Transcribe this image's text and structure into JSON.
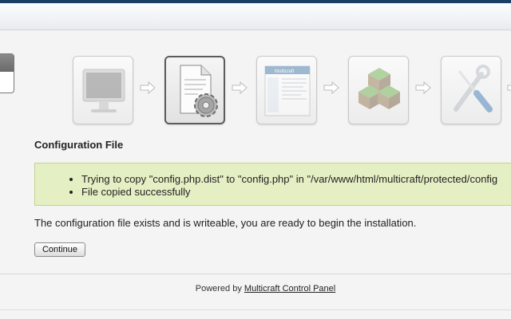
{
  "wizard": {
    "steps": [
      {
        "name": "welcome",
        "icon": "monitor-icon",
        "state": "completed"
      },
      {
        "name": "configuration-file",
        "icon": "config-document-gear-icon",
        "state": "current"
      },
      {
        "name": "panel-setup",
        "icon": "multicraft-panel-icon",
        "state": "upcoming",
        "label": "Multicraft"
      },
      {
        "name": "minecraft",
        "icon": "grass-blocks-icon",
        "state": "upcoming"
      },
      {
        "name": "tools",
        "icon": "screwdriver-wrench-icon",
        "state": "upcoming"
      }
    ]
  },
  "content": {
    "section_title": "Configuration File",
    "messages": [
      "Trying to copy \"config.php.dist\" to \"config.php\" in \"/var/www/html/multicraft/protected/config",
      "File copied successfully"
    ],
    "status_text": "The configuration file exists and is writeable, you are ready to begin the installation.",
    "continue_label": "Continue"
  },
  "footer": {
    "powered_by": "Powered by",
    "link_text": "Multicraft Control Panel"
  },
  "colors": {
    "top_stripe": "#1c3f66",
    "message_background": "#e5efc4",
    "message_border": "#c4d38b"
  }
}
